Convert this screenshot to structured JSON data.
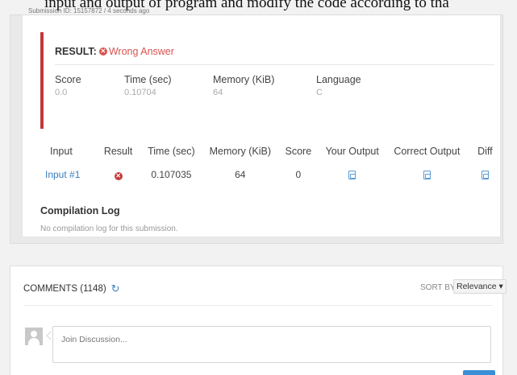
{
  "caption": "input and output of program and modify the code according to tha",
  "submission_id": "Submission ID: 15157872 / 4 seconds ago",
  "result": {
    "label": "RESULT:",
    "verdict": "Wrong Answer",
    "stats": [
      {
        "label": "Score",
        "value": "0.0"
      },
      {
        "label": "Time (sec)",
        "value": "0.10704"
      },
      {
        "label": "Memory (KiB)",
        "value": "64"
      },
      {
        "label": "Language",
        "value": "C"
      }
    ]
  },
  "tests": {
    "headers": [
      "Input",
      "Result",
      "Time (sec)",
      "Memory (KiB)",
      "Score",
      "Your Output",
      "Correct Output",
      "Diff"
    ],
    "rows": [
      {
        "input": "Input #1",
        "time": "0.107035",
        "memory": "64",
        "score": "0"
      }
    ]
  },
  "compilation": {
    "title": "Compilation Log",
    "text": "No compilation log for this submission."
  },
  "comments": {
    "title": "COMMENTS (1148)",
    "sort_label": "SORT BY:",
    "sort_value": "Relevance",
    "placeholder": "Join Discussion..."
  },
  "colors": {
    "accent_red": "#d9534f",
    "link_blue": "#3a7fc0",
    "button_blue": "#3b8fd6"
  }
}
